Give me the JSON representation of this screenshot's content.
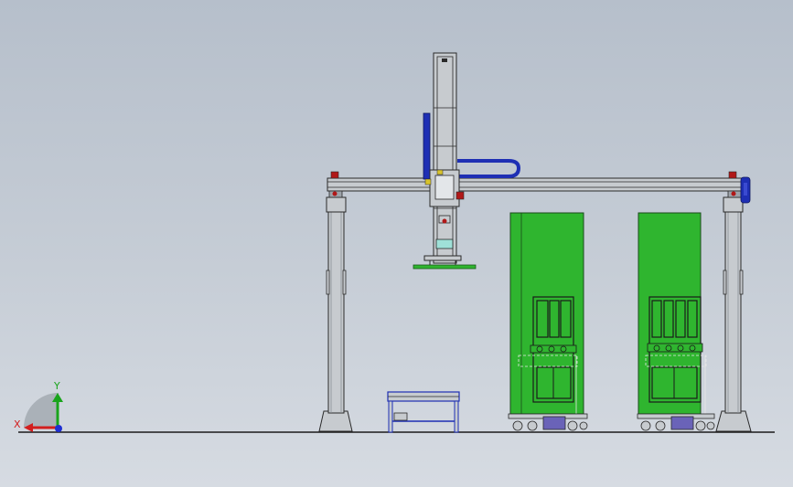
{
  "triad": {
    "x_label": "X",
    "y_label": "Y",
    "x_color": "#d21e1e",
    "y_color": "#19a41c",
    "z_color": "#1e2fd2"
  },
  "colors": {
    "frame_gray": "#c7cbcf",
    "frame_outline": "#2a2a2a",
    "press_green": "#2fb52f",
    "hose_blue": "#1e2fb4",
    "fastener_red": "#b01818",
    "die_purple": "#6a63b8",
    "ground_line": "#1a1a1a"
  },
  "scene": {
    "objects": [
      "gantry-robot",
      "gripper-column",
      "press-1",
      "press-2",
      "work-table"
    ]
  }
}
